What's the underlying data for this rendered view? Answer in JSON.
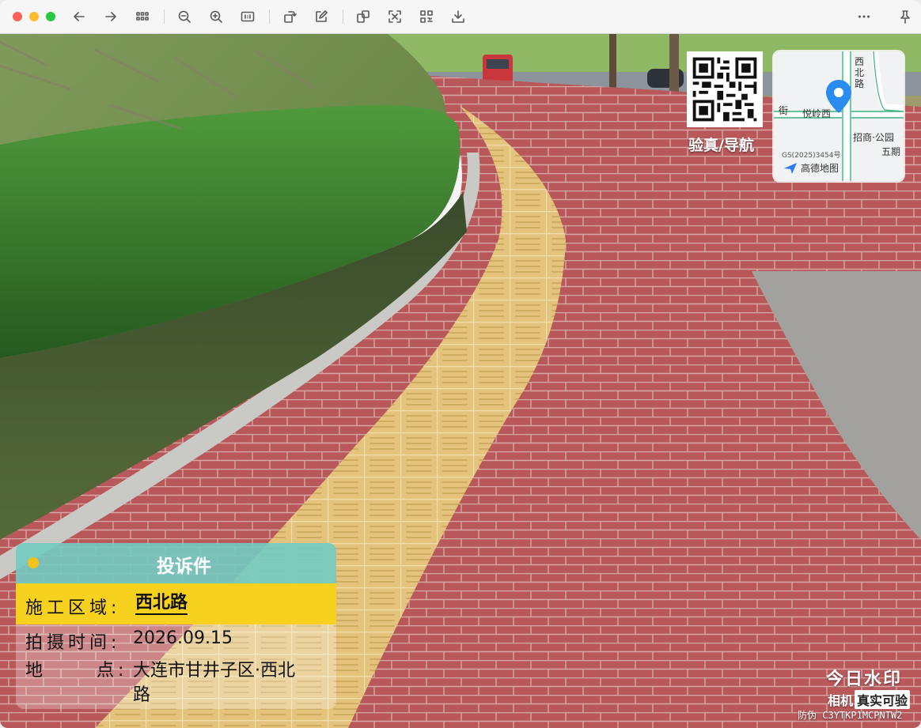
{
  "toolbar": {
    "buttons": [
      "back",
      "forward",
      "grid-view",
      "zoom-out",
      "zoom-in",
      "actual-size",
      "rotate",
      "markup",
      "crop",
      "adjust",
      "qr",
      "save",
      "more",
      "pin"
    ]
  },
  "qr": {
    "label": "验真/导航"
  },
  "map": {
    "road_ns": "西北路",
    "road_ew_left": "街",
    "road_ew": "悦岭西",
    "poi": "招商·公园",
    "poi2": "五期",
    "gs_code": "GS(2025)3454号",
    "brand": "高德地图",
    "pin_color": "#2a8cf0"
  },
  "card": {
    "title": "投诉件",
    "rows": [
      {
        "label": "施工区域:",
        "value": "西北路"
      },
      {
        "label": "拍摄时间:",
        "value": "2026.09.15"
      },
      {
        "label_a": "地",
        "label_b": "点:",
        "value_line1": "大连市甘井子区·西北",
        "value_line2": "路"
      }
    ],
    "header_color": "#6ec8be",
    "highlight_color": "#f6d21f"
  },
  "watermark": {
    "title": "今日水印",
    "sub_a": "相机",
    "sub_b": "真实可验",
    "code_prefix": "防伪",
    "code": "C3YTKP1MCPNTW2"
  }
}
